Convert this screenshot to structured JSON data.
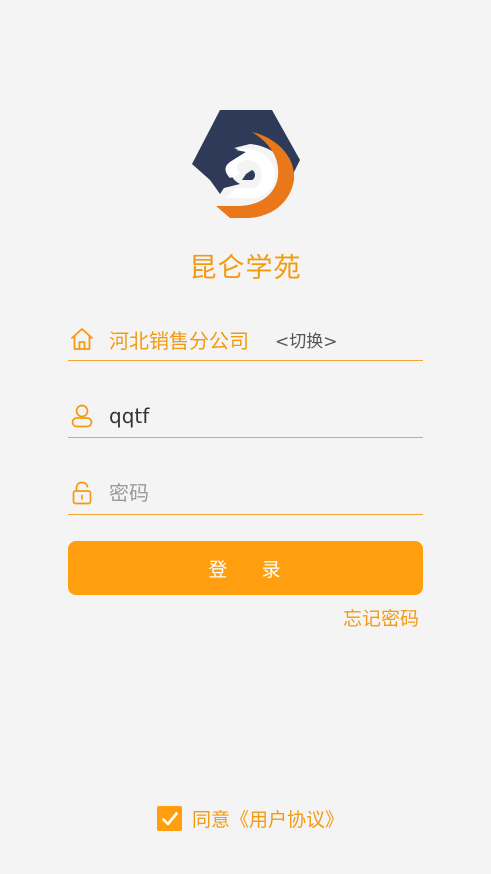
{
  "app": {
    "title": "昆仑学苑"
  },
  "login_form": {
    "company": {
      "name": "河北销售分公司",
      "switch_label": "<切换>",
      "icon": "home-icon"
    },
    "username": {
      "value": "qqtf",
      "icon": "user-icon"
    },
    "password": {
      "value": "",
      "placeholder": "密码",
      "icon": "lock-icon"
    },
    "login_label": "登    录",
    "forgot_label": "忘记密码"
  },
  "agreement": {
    "checked": true,
    "label": "同意《用户协议》"
  },
  "colors": {
    "accent": "#ff9f10",
    "accent_text": "#f39a12",
    "logo_navy": "#2e3a57",
    "logo_orange": "#e8781a",
    "background": "#f4f4f4"
  }
}
